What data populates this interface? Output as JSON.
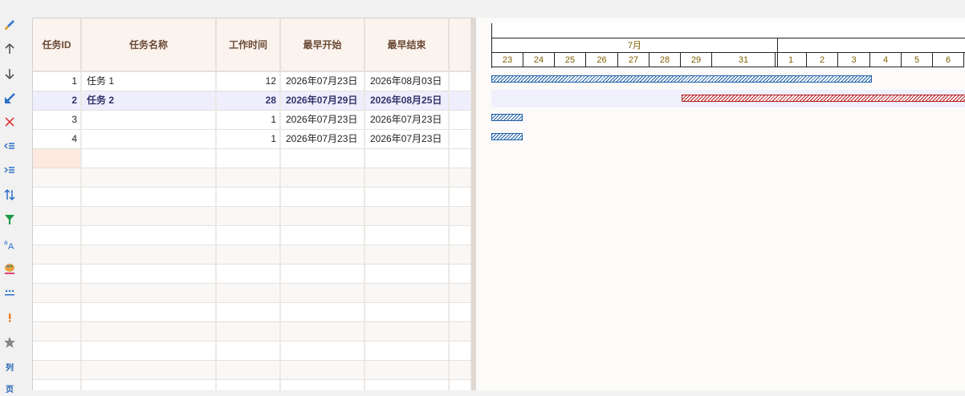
{
  "toolbar": {
    "items": [
      {
        "icon": "brush-icon"
      },
      {
        "icon": "arrow-up-icon"
      },
      {
        "icon": "arrow-down-icon"
      },
      {
        "icon": "arrow-down-left-icon"
      },
      {
        "icon": "close-icon"
      },
      {
        "icon": "outdent-icon"
      },
      {
        "icon": "indent-icon"
      },
      {
        "icon": "sort-icon"
      },
      {
        "icon": "filter-icon"
      },
      {
        "icon": "font-icon"
      },
      {
        "icon": "palette-icon"
      },
      {
        "icon": "more-icon"
      },
      {
        "icon": "exclamation-icon"
      },
      {
        "icon": "star-icon"
      }
    ],
    "col_label": "列",
    "page_label": "页"
  },
  "grid": {
    "headers": [
      "任务ID",
      "任务名称",
      "工作时间",
      "最早开始",
      "最早结束"
    ],
    "rows": [
      {
        "id": "1",
        "name": "任务 1",
        "work": "12",
        "start": "2026年07月23日",
        "end": "2026年08月03日"
      },
      {
        "id": "2",
        "name": "任务 2",
        "work": "28",
        "start": "2026年07月29日",
        "end": "2026年08月25日"
      },
      {
        "id": "3",
        "name": "",
        "work": "1",
        "start": "2026年07月23日",
        "end": "2026年07月23日"
      },
      {
        "id": "4",
        "name": "",
        "work": "1",
        "start": "2026年07月23日",
        "end": "2026年07月23日"
      }
    ]
  },
  "gantt": {
    "month_label": "7月",
    "days": [
      "23",
      "24",
      "25",
      "26",
      "27",
      "28",
      "29",
      "31",
      "1",
      "2",
      "3",
      "4",
      "5",
      "6"
    ],
    "colors": {
      "normal": "#1e5fa8",
      "selected": "#b51c1c"
    }
  }
}
